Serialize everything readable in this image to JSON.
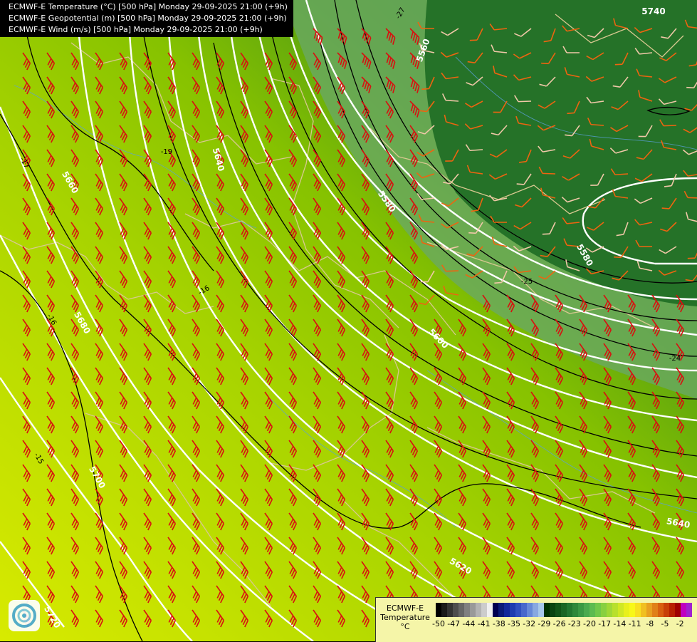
{
  "header": {
    "lines": [
      "ECMWF-E Temperature (°C) [500 hPa] Monday 29-09-2025 21:00 (+9h)",
      "ECMWF-E Geopotential (m) [500 hPa] Monday 29-09-2025 21:00 (+9h)",
      "ECMWF-E Wind (m/s) [500 hPa] Monday 29-09-2025 21:00 (+9h)"
    ]
  },
  "contours": {
    "geopotential_labels": [
      "5560",
      "5580",
      "5580",
      "5600",
      "5620",
      "5640",
      "5640",
      "5660",
      "5680",
      "5700",
      "5720",
      "5740"
    ],
    "temperature_labels": [
      "-27",
      "-19",
      "-17",
      "-16",
      "-16",
      "-15",
      "-25",
      "-24"
    ]
  },
  "legend": {
    "title_line1": "ECMWF-E",
    "title_line2": "Temperature",
    "unit": "°C",
    "ticks": [
      "-50",
      "-47",
      "-44",
      "-41",
      "-38",
      "-35",
      "-32",
      "-29",
      "-26",
      "-23",
      "-20",
      "-17",
      "-14",
      "-11",
      "-8",
      "-5",
      "-2"
    ],
    "colors": [
      "#000000",
      "#1a1a1a",
      "#333333",
      "#4d4d4d",
      "#666666",
      "#808080",
      "#999999",
      "#b3b3b3",
      "#cccccc",
      "#f0f0f0",
      "#000050",
      "#0a1a78",
      "#12289a",
      "#1e3cb0",
      "#3050c0",
      "#4868cc",
      "#6688d8",
      "#88a8e0",
      "#a8c8ea",
      "#003300",
      "#0a4410",
      "#125518",
      "#1a6624",
      "#227730",
      "#2e883a",
      "#3a9944",
      "#4aaa4e",
      "#5cbb50",
      "#70c84a",
      "#88d040",
      "#a0d836",
      "#b8e02c",
      "#d0e824",
      "#e8f01c",
      "#f8f818",
      "#f8e020",
      "#f0c020",
      "#e8a020",
      "#e08018",
      "#d86010",
      "#c84008",
      "#b82000",
      "#a00000",
      "#c000c0",
      "#a020d0",
      "#8030c0",
      "#6030b0",
      "#3a2090"
    ]
  },
  "logo": {
    "icon": "ecmwf-logo-icon"
  },
  "map_colors": {
    "cold_core": "#216a23",
    "mid": "#88c400",
    "warm": "#d6e800",
    "isohypse": "#ffffff",
    "isotherm": "#000000",
    "borders": "#d8c890",
    "wind_barb_strong": "#d81010",
    "wind_barb_moderate": "#ee6410",
    "wind_barb_light": "#f0c8a8"
  }
}
